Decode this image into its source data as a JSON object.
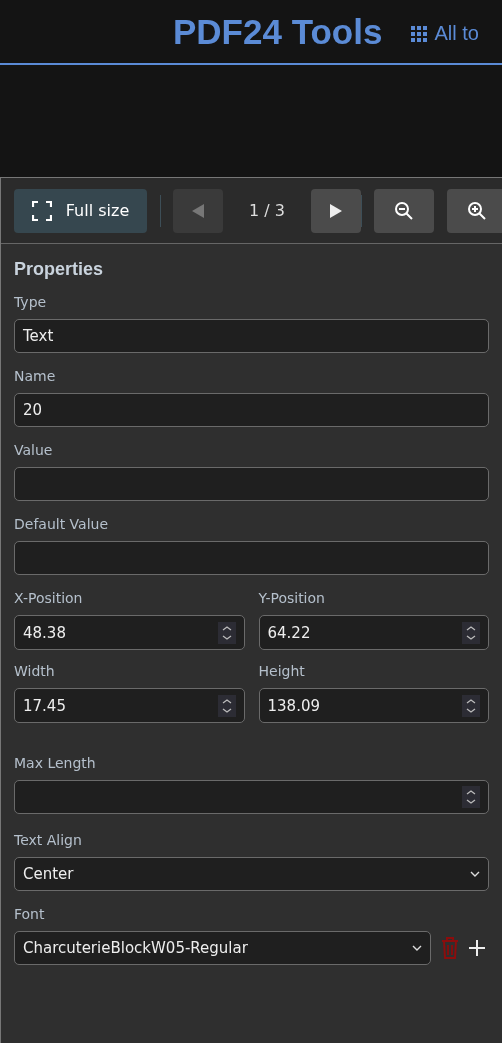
{
  "header": {
    "title": "PDF24 Tools",
    "nav_link": "All to"
  },
  "toolbar": {
    "fullsize_label": "Full size",
    "prev_disabled": true,
    "next_disabled": false,
    "page_indicator": "1 / 3"
  },
  "properties": {
    "title": "Properties",
    "items": [
      {
        "kind": "text",
        "label": "Type",
        "value": "Text"
      },
      {
        "kind": "text",
        "label": "Name",
        "value": "20"
      },
      {
        "kind": "text",
        "label": "Value"
      },
      {
        "kind": "text",
        "label": "Default Value"
      },
      {
        "kind": "pair",
        "fields": [
          {
            "label": "X-Position",
            "value": "48.38"
          },
          {
            "label": "Y-Position",
            "value": "64.22"
          }
        ]
      },
      {
        "kind": "pair",
        "fields": [
          {
            "label": "Width",
            "value": "17.45"
          },
          {
            "label": "Height",
            "value": "138.09"
          }
        ]
      },
      {
        "kind": "number",
        "label": "Max Length"
      },
      {
        "kind": "select",
        "label": "Text Align",
        "value": "Center"
      },
      {
        "kind": "font",
        "label": "Font",
        "value": "CharcuterieBlockW05-Regular"
      }
    ]
  }
}
